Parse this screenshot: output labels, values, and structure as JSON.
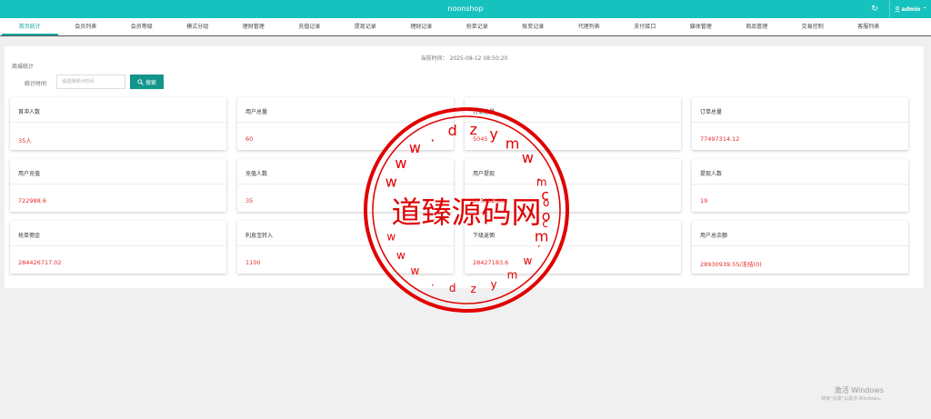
{
  "app": {
    "title": "noonshop"
  },
  "header": {
    "user": "admin"
  },
  "nav": {
    "tabs": [
      "首页统计",
      "会员列表",
      "会员等级",
      "模式分组",
      "理财管理",
      "充值记录",
      "提现记录",
      "理财记录",
      "抢单记录",
      "账变记录",
      "代理列表",
      "支付接口",
      "媒体管理",
      "商品管理",
      "交易控制",
      "客服列表"
    ]
  },
  "stats": {
    "date_label": "当前时间：",
    "date": "2025-08-12 08:50:20",
    "section_title": "商城统计",
    "filter_label": "统计时间",
    "filter_placeholder": "请选择统计时间",
    "search_button": "搜索"
  },
  "cards": [
    {
      "label": "首冲人数",
      "value": "35人"
    },
    {
      "label": "用户总量",
      "value": "60"
    },
    {
      "label": "订单总量",
      "value": "5045"
    },
    {
      "label": "订单总量",
      "value": "77497314.12"
    },
    {
      "label": "用户充值",
      "value": "722988.6"
    },
    {
      "label": "充值人数",
      "value": "35"
    },
    {
      "label": "用户提现",
      "value": "675632.66"
    },
    {
      "label": "提现人数",
      "value": "19"
    },
    {
      "label": "抢单佣金",
      "value": "284426717.02"
    },
    {
      "label": "利息宝转入",
      "value": "1100"
    },
    {
      "label": "下级返佣",
      "value": "28427183.6"
    },
    {
      "label": "用户总余额",
      "value": "28930939.55/冻结(0)"
    }
  ],
  "watermark": {
    "seal_text": "道臻源码网",
    "seal_url": "www.dzymw.com",
    "windows_title": "激活 Windows",
    "windows_sub": "转到\"设置\"以激活 Windows。"
  },
  "colors": {
    "topbar": "#16c2bd",
    "accent": "#12958a",
    "value_red": "#e42b2b",
    "seal_red": "#e00000"
  },
  "icons": {
    "refresh": "refresh-icon",
    "user": "user-icon",
    "search": "search-icon",
    "chevron": "chevron-up-icon"
  }
}
